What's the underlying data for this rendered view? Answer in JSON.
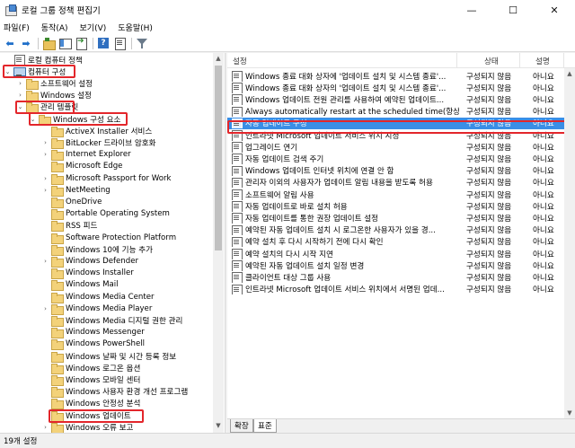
{
  "window": {
    "title": "로컬 그룹 정책 편집기",
    "minimize_glyph": "—",
    "maximize_glyph": "☐",
    "close_glyph": "✕"
  },
  "menu": [
    "파일(F)",
    "동작(A)",
    "보기(V)",
    "도움말(H)"
  ],
  "toolbar": {
    "icons": [
      "back-arrow-icon",
      "forward-arrow-icon",
      "up-folder-icon",
      "show-console-tree-icon",
      "export-list-icon",
      "help-icon",
      "properties-icon",
      "filter-icon"
    ],
    "back_glyph": "⬅",
    "forward_glyph": "➡"
  },
  "tree": {
    "items": [
      {
        "label": "로컬 컴퓨터 정책",
        "icon": "policy",
        "expander": ""
      },
      {
        "label": "컴퓨터 구성",
        "icon": "computer",
        "expander": "⌄"
      },
      {
        "label": "소프트웨어 설정",
        "icon": "folder",
        "expander": "›"
      },
      {
        "label": "Windows 설정",
        "icon": "folder",
        "expander": "›"
      },
      {
        "label": "관리 템플릿",
        "icon": "folder",
        "expander": "⌄"
      },
      {
        "label": "Windows 구성 요소",
        "icon": "folder",
        "expander": "⌄"
      },
      {
        "label": "ActiveX Installer 서비스",
        "icon": "folder",
        "expander": ""
      },
      {
        "label": "BitLocker 드라이브 암호화",
        "icon": "folder",
        "expander": "›"
      },
      {
        "label": "Internet Explorer",
        "icon": "folder",
        "expander": "›"
      },
      {
        "label": "Microsoft Edge",
        "icon": "folder",
        "expander": ""
      },
      {
        "label": "Microsoft Passport for Work",
        "icon": "folder",
        "expander": "›"
      },
      {
        "label": "NetMeeting",
        "icon": "folder",
        "expander": "›"
      },
      {
        "label": "OneDrive",
        "icon": "folder",
        "expander": ""
      },
      {
        "label": "Portable Operating System",
        "icon": "folder",
        "expander": ""
      },
      {
        "label": "RSS 피드",
        "icon": "folder",
        "expander": ""
      },
      {
        "label": "Software Protection Platform",
        "icon": "folder",
        "expander": ""
      },
      {
        "label": "Windows 10에 기능 추가",
        "icon": "folder",
        "expander": ""
      },
      {
        "label": "Windows Defender",
        "icon": "folder",
        "expander": "›"
      },
      {
        "label": "Windows Installer",
        "icon": "folder",
        "expander": ""
      },
      {
        "label": "Windows Mail",
        "icon": "folder",
        "expander": ""
      },
      {
        "label": "Windows Media Center",
        "icon": "folder",
        "expander": ""
      },
      {
        "label": "Windows Media Player",
        "icon": "folder",
        "expander": "›"
      },
      {
        "label": "Windows Media 디지털 권한 관리",
        "icon": "folder",
        "expander": ""
      },
      {
        "label": "Windows Messenger",
        "icon": "folder",
        "expander": ""
      },
      {
        "label": "Windows PowerShell",
        "icon": "folder",
        "expander": ""
      },
      {
        "label": "Windows 날짜 및 시간 등록 정보",
        "icon": "folder",
        "expander": ""
      },
      {
        "label": "Windows 로그온 옵션",
        "icon": "folder",
        "expander": ""
      },
      {
        "label": "Windows 모바일 센터",
        "icon": "folder",
        "expander": ""
      },
      {
        "label": "Windows 사용자 환경 개선 프로그램",
        "icon": "folder",
        "expander": ""
      },
      {
        "label": "Windows 안정성 분석",
        "icon": "folder",
        "expander": ""
      },
      {
        "label": "Windows 업데이트",
        "icon": "folder",
        "expander": ""
      },
      {
        "label": "Windows 오류 보고",
        "icon": "folder",
        "expander": "›"
      }
    ],
    "scroll_up": "▲",
    "scroll_down": "▼"
  },
  "list": {
    "columns": [
      "설정",
      "상태",
      "설명"
    ],
    "rows": [
      {
        "name": "Windows 종료 대화 상자에 '업데이트 설치 및 시스템 종료'...",
        "state": "구성되지 않음",
        "comment": "아니요"
      },
      {
        "name": "Windows 종료 대화 상자의 '업데이트 설치 및 시스템 종료'...",
        "state": "구성되지 않음",
        "comment": "아니요"
      },
      {
        "name": "Windows 업데이트 전원 관리를 사용하여 예약된 업데이트...",
        "state": "구성되지 않음",
        "comment": "아니요"
      },
      {
        "name": "Always automatically restart at the scheduled time(항상 예...",
        "state": "구성되지 않음",
        "comment": "아니요"
      },
      {
        "name": "자동 업데이트 구성",
        "state": "구성되지 않음",
        "comment": "아니요"
      },
      {
        "name": "인트라넷 Microsoft 업데이트 서비스 위치 지정",
        "state": "구성되지 않음",
        "comment": "아니요"
      },
      {
        "name": "업그레이드 연기",
        "state": "구성되지 않음",
        "comment": "아니요"
      },
      {
        "name": "자동 업데이트 검색 주기",
        "state": "구성되지 않음",
        "comment": "아니요"
      },
      {
        "name": "Windows 업데이트 인터넷 위치에 연결 안 함",
        "state": "구성되지 않음",
        "comment": "아니요"
      },
      {
        "name": "관리자 이외의 사용자가 업데이트 알림 내용을 받도록 허용",
        "state": "구성되지 않음",
        "comment": "아니요"
      },
      {
        "name": "소프트웨어 알림 사용",
        "state": "구성되지 않음",
        "comment": "아니요"
      },
      {
        "name": "자동 업데이트로 바로 설치 허용",
        "state": "구성되지 않음",
        "comment": "아니요"
      },
      {
        "name": "자동 업데이트를 통한 권장 업데이트 설정",
        "state": "구성되지 않음",
        "comment": "아니요"
      },
      {
        "name": "예약된 자동 업데이트 설치 시 로그온한 사용자가 있을 경...",
        "state": "구성되지 않음",
        "comment": "아니요"
      },
      {
        "name": "예약 설치 후 다시 시작하기 전에 다시 확인",
        "state": "구성되지 않음",
        "comment": "아니요"
      },
      {
        "name": "예약 설치의 다시 시작 지연",
        "state": "구성되지 않음",
        "comment": "아니요"
      },
      {
        "name": "예약된 자동 업데이트 설치 일정 변경",
        "state": "구성되지 않음",
        "comment": "아니요"
      },
      {
        "name": "클라이언트 대상 그룹 사용",
        "state": "구성되지 않음",
        "comment": "아니요"
      },
      {
        "name": "인트라넷 Microsoft 업데이트 서비스 위치에서 서명된 업데...",
        "state": "구성되지 않음",
        "comment": "아니요"
      }
    ],
    "selected_index": 4
  },
  "tabs": [
    "확장",
    "표준"
  ],
  "status": "19개 설정",
  "colors": {
    "highlight": "#e3262b",
    "selection": "#3a8ee6"
  }
}
